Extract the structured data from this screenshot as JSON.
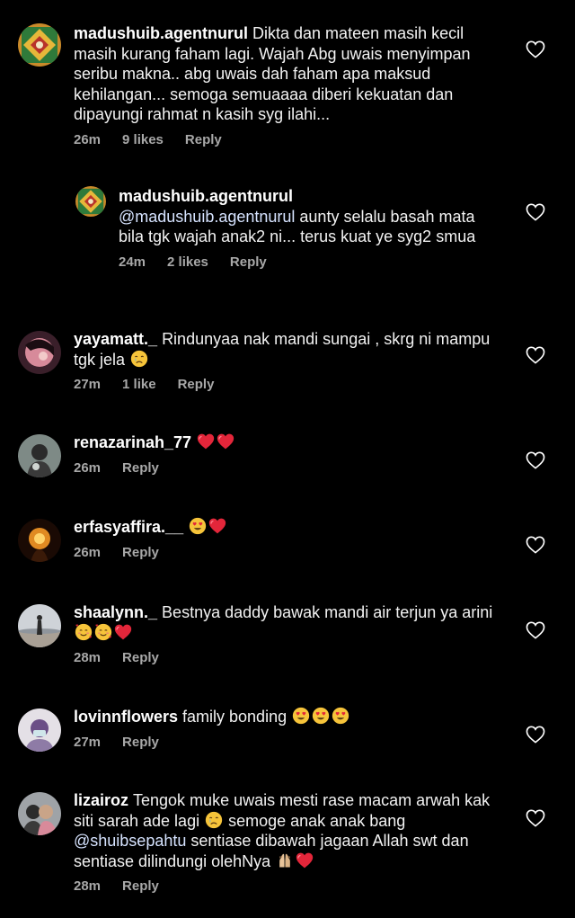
{
  "comments": [
    {
      "username": "madushuib.agentnurul",
      "text": "Dikta dan mateen masih kecil masih kurang faham lagi. Wajah Abg uwais menyimpan seribu makna.. abg uwais dah faham apa maksud kehilangan... semoga semuaaaa diberi kekuatan dan dipayungi rahmat n kasih syg ilahi...",
      "time": "26m",
      "likes": "9 likes",
      "reply_label": "Reply"
    },
    {
      "username": "madushuib.agentnurul",
      "mention": "@madushuib.agentnurul",
      "text": " aunty selalu basah mata bila tgk wajah anak2 ni... terus kuat ye syg2 smua",
      "time": "24m",
      "likes": "2 likes",
      "reply_label": "Reply"
    },
    {
      "username": "yayamatt._",
      "text": "Rindunyaa nak mandi sungai , skrg ni mampu tgk jela ",
      "time": "27m",
      "likes": "1 like",
      "reply_label": "Reply"
    },
    {
      "username": "renazarinah_77",
      "text": "",
      "time": "26m",
      "reply_label": "Reply"
    },
    {
      "username": "erfasyaffira.__",
      "text": "",
      "time": "26m",
      "reply_label": "Reply"
    },
    {
      "username": "shaalynn._",
      "text": "Bestnya daddy bawak mandi air terjun ya arini ",
      "time": "28m",
      "reply_label": "Reply"
    },
    {
      "username": "lovinnflowers",
      "text": "family bonding ",
      "time": "27m",
      "reply_label": "Reply"
    },
    {
      "username": "lizairoz",
      "text": "Tengok muke uwais mesti rase macam arwah kak siti sarah ade lagi ",
      "text2": " semoge anak anak bang ",
      "mention": "@shuibsepahtu",
      "text3": " sentiase dibawah jagaan Allah swt dan sentiase dilindungi olehNya ",
      "time": "28m",
      "reply_label": "Reply"
    }
  ],
  "icons": {
    "heart": "heart-outline-icon",
    "emojis": [
      "crying-face-emoji",
      "red-heart-emoji",
      "heart-eyes-emoji",
      "smiling-face-with-hearts-emoji",
      "folded-hands-emoji"
    ]
  },
  "colors": {
    "background": "#000000",
    "text": "#f2f2f2",
    "meta": "#a8a8a8",
    "mention": "#d6e3ff",
    "heart_red": "#e3263a"
  }
}
